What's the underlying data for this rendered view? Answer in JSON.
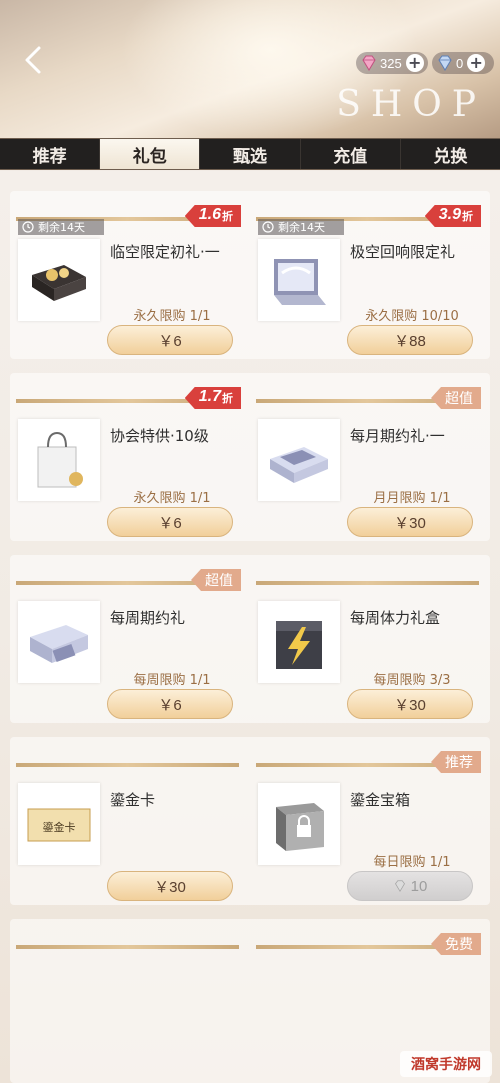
{
  "header": {
    "currency_pink": "325",
    "currency_blue": "0",
    "shop_logo": "SHOP"
  },
  "tabs": [
    {
      "label": "推荐",
      "active": false
    },
    {
      "label": "礼包",
      "active": true
    },
    {
      "label": "甄选",
      "active": false
    },
    {
      "label": "充值",
      "active": false
    },
    {
      "label": "兑换",
      "active": false
    }
  ],
  "cards": [
    {
      "name": "临空限定初礼·一",
      "limit": "永久限购 1/1",
      "price": "￥6",
      "timer": "剩余14天",
      "badge": {
        "type": "discount",
        "value": "1.6",
        "unit": "折"
      },
      "icon": "gift-box-icon"
    },
    {
      "name": "极空回响限定礼",
      "limit": "永久限购 10/10",
      "price": "￥88",
      "timer": "剩余14天",
      "badge": {
        "type": "discount",
        "value": "3.9",
        "unit": "折"
      },
      "icon": "jewelry-case-icon"
    },
    {
      "name": "协会特供·10级",
      "limit": "永久限购 1/1",
      "price": "￥6",
      "badge": {
        "type": "discount",
        "value": "1.7",
        "unit": "折"
      },
      "icon": "shopping-bag-icon"
    },
    {
      "name": "每月期约礼·一",
      "limit": "月月限购 1/1",
      "price": "￥30",
      "badge": {
        "type": "label",
        "value": "超值"
      },
      "icon": "drawer-box-icon"
    },
    {
      "name": "每周期约礼",
      "limit": "每周限购 1/1",
      "price": "￥6",
      "badge": {
        "type": "label",
        "value": "超值"
      },
      "icon": "drawer-box-icon"
    },
    {
      "name": "每周体力礼盒",
      "limit": "每周限购 3/3",
      "price": "￥30",
      "icon": "lightning-bag-icon"
    },
    {
      "name": "鎏金卡",
      "price": "￥30",
      "icon": "gold-card-icon",
      "card_text": "鎏金卡"
    },
    {
      "name": "鎏金宝箱",
      "limit": "每日限购 1/1",
      "price": "10",
      "price_disabled": true,
      "badge": {
        "type": "label",
        "value": "推荐"
      },
      "icon": "locked-chest-icon"
    },
    {
      "badge": {
        "type": "label",
        "value": "免费"
      }
    }
  ],
  "watermark": "酒窝手游网",
  "colors": {
    "accent_gold": "#d9b47e",
    "discount_red": "#d9403c",
    "tab_dark": "#22201f",
    "label_pink": "#e2aa8c"
  }
}
